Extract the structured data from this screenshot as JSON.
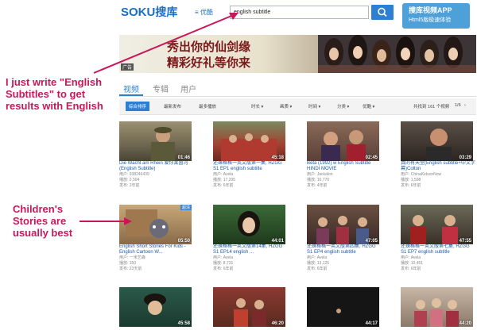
{
  "header": {
    "logo_latin": "SOKU",
    "logo_cn": "搜库",
    "category": "≡ 优酷",
    "search_value": "english subtitle",
    "app_title": "搜库视频APP",
    "app_sub": "Html5版极速体验"
  },
  "banner": {
    "line1": "秀出你的仙剑缘",
    "line2": "精彩好礼等你来",
    "ad_label": "广告"
  },
  "tabs": [
    "视频",
    "专辑",
    "用户"
  ],
  "filters": {
    "sort_tabs": [
      "综合排序",
      "最新发布",
      "最多播放"
    ],
    "dropdowns": [
      "时长 ▾",
      "画质 ▾",
      "时间 ▾",
      "分类 ▾",
      "优酷 ▾"
    ],
    "result_count": "共找到 161 个视频",
    "pager": "1/6"
  },
  "results": [
    {
      "title": "Die Wacht am Rhein 爱你莱茵河(English Subtitle)",
      "user": "用户: 938246439",
      "plays": "播放: 2,504",
      "date": "发布: 2年前",
      "duration": "01:46",
      "hd": ""
    },
    {
      "title": "还珠格格一英文版第一集, HZGG S1 EP1 english subtitle",
      "user": "用户: Avela",
      "plays": "播放: 17,205",
      "date": "发布: 6年前",
      "duration": "45:18",
      "hd": ""
    },
    {
      "title": "Beta (1992) w English Subtitle HINDI MOVIE",
      "user": "用户: Jackalon",
      "plays": "播放: 10,770",
      "date": "发布: 4年前",
      "duration": "02:45",
      "hd": ""
    },
    {
      "title": "真的有天堂(English subtitle+中文字幕)Colton",
      "user": "用户: ChinaKidsonNow",
      "plays": "播放: 1,598",
      "date": "发布: 6年前",
      "duration": "03:29",
      "hd": ""
    },
    {
      "title": "English Short Stories For Kids - English Cartoon W...",
      "user": "用户: 一米艺森",
      "plays": "播放: 150",
      "date": "发布: 23天前",
      "duration": "05:50",
      "hd": "超清"
    },
    {
      "title": "还珠格格一英文版第14集, HZGG S1 EP14 english ...",
      "user": "用户: Avela",
      "plays": "播放: 8,731",
      "date": "发布: 6年前",
      "duration": "44:01",
      "hd": ""
    },
    {
      "title": "还珠格格一英文版第四集, HZGG S1 EP4 english subtitle",
      "user": "用户: Avela",
      "plays": "播放: 13,125",
      "date": "发布: 6年前",
      "duration": "47:05",
      "hd": ""
    },
    {
      "title": "还珠格格一英文版第七集, HZGG S1 EP7 english subtitle",
      "user": "用户: Avela",
      "plays": "播放: 10,451",
      "date": "发布: 6年前",
      "duration": "47:55",
      "hd": ""
    },
    {
      "title": "",
      "user": "",
      "plays": "",
      "date": "",
      "duration": "45:58",
      "hd": ""
    },
    {
      "title": "",
      "user": "",
      "plays": "",
      "date": "",
      "duration": "46:20",
      "hd": ""
    },
    {
      "title": "",
      "user": "",
      "plays": "",
      "date": "",
      "duration": "44:17",
      "hd": ""
    },
    {
      "title": "",
      "user": "",
      "plays": "",
      "date": "",
      "duration": "44:20",
      "hd": ""
    }
  ],
  "annotations": {
    "note1": "I just write \"English Subtitles\" to get results with English",
    "note2": "Children's Stories are usually best"
  },
  "colors": {
    "accent": "#2d7fd3",
    "annotation": "#c8185a"
  }
}
